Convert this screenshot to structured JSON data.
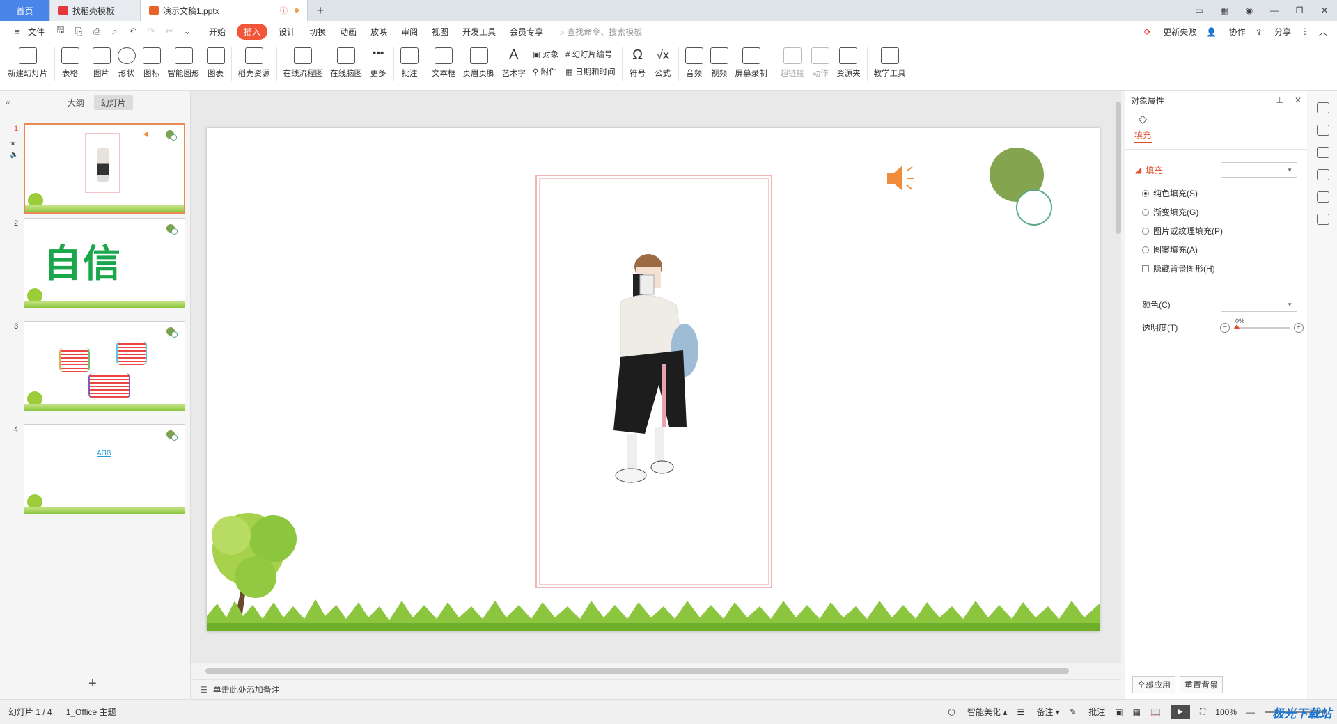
{
  "titlebar": {
    "tabs": [
      {
        "label": "首页"
      },
      {
        "label": "找稻壳模板"
      },
      {
        "label": "演示文稿1.pptx"
      }
    ]
  },
  "menubar": {
    "file": "文件",
    "items": [
      "开始",
      "插入",
      "设计",
      "切换",
      "动画",
      "放映",
      "审阅",
      "视图",
      "开发工具",
      "会员专享"
    ],
    "active": "插入",
    "search_placeholder": "查找命令、搜索模板",
    "right": [
      "更新失败",
      "协作",
      "分享"
    ]
  },
  "ribbon": {
    "buttons": [
      "新建幻灯片",
      "表格",
      "图片",
      "形状",
      "图标",
      "智能图形",
      "图表",
      "稻壳资源",
      "在线流程图",
      "在线脑图",
      "更多",
      "批注",
      "文本框",
      "页眉页脚",
      "艺术字"
    ],
    "small_col1": [
      "对象",
      "附件"
    ],
    "small_col2": [
      "幻灯片编号",
      "日期和时间"
    ],
    "buttons2": [
      "符号",
      "公式",
      "音频",
      "视频",
      "屏幕录制",
      "超链接",
      "动作",
      "资源夹",
      "教学工具"
    ]
  },
  "leftpanel": {
    "tabs": [
      "大纲",
      "幻灯片"
    ],
    "slides": [
      {
        "num": "1"
      },
      {
        "num": "2",
        "text": "自信"
      },
      {
        "num": "3"
      },
      {
        "num": "4",
        "text": "AПB"
      }
    ]
  },
  "notes": {
    "placeholder": "单击此处添加备注"
  },
  "rightpanel": {
    "title": "对象属性",
    "tab": "填充",
    "section": "填充",
    "options": [
      "纯色填充(S)",
      "渐变填充(G)",
      "图片或纹理填充(P)",
      "图案填充(A)"
    ],
    "checkbox": "隐藏背景图形(H)",
    "color_label": "颜色(C)",
    "transparency_label": "透明度(T)",
    "transparency_value": "0%",
    "buttons": [
      "全部应用",
      "重置背景"
    ]
  },
  "statusbar": {
    "slide_info": "幻灯片 1 / 4",
    "theme": "1_Office 主题",
    "smart": "智能美化",
    "notes": "备注",
    "comments": "批注",
    "zoom": "100%",
    "watermark": "极光下载站"
  },
  "colors": {
    "accent": "#f1563b",
    "slide_circle": "#84a450",
    "ring": "#5aa883",
    "speaker": "#f08c3c",
    "text_green": "#1aa64a"
  }
}
